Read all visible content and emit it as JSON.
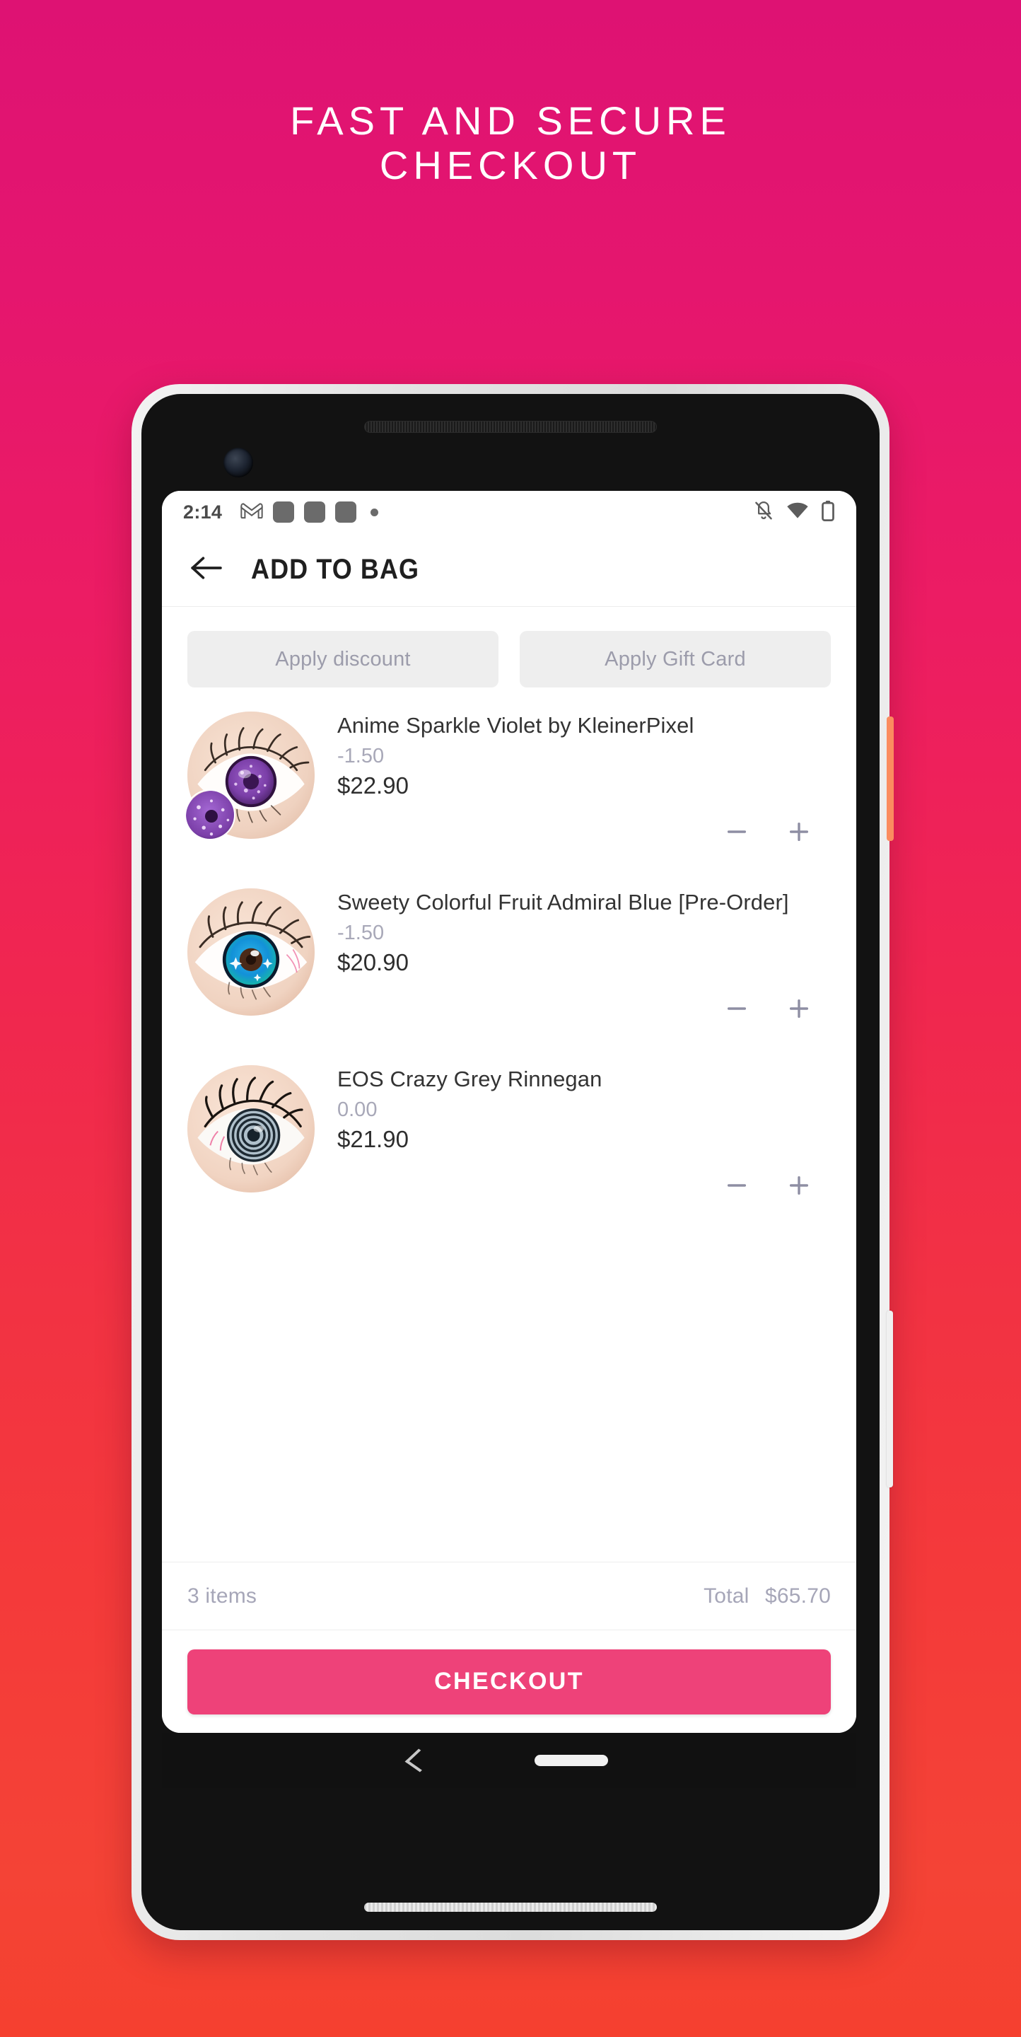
{
  "poster": {
    "headline": "FAST AND SECURE\nCHECKOUT",
    "bg_top_color": "#DE1273",
    "bg_bottom_color": "#F5402F"
  },
  "status_bar": {
    "time": "2:14",
    "left_icons": [
      "gmail-icon",
      "app-square-icon",
      "app-square-icon",
      "app-square-icon",
      "notification-dot-icon"
    ],
    "right_icons": [
      "bell-off-icon",
      "wifi-icon",
      "battery-icon"
    ]
  },
  "app_bar": {
    "back_icon": "arrow-left-icon",
    "title": "ADD TO BAG"
  },
  "promo": {
    "discount_label": "Apply discount",
    "gift_card_label": "Apply Gift Card"
  },
  "cart": {
    "items": [
      {
        "title": "Anime Sparkle Violet by KleinerPixel",
        "power": "-1.50",
        "price": "$22.90",
        "thumb_name": "product-thumb-anime-sparkle-violet",
        "has_swatch": true,
        "swatch_name": "color-swatch-violet",
        "iris_color": "#7B3FA8",
        "iris_color_2": "#9C5FC8",
        "iris_type": "sparkle",
        "minus_icon": "minus-icon",
        "plus_icon": "plus-icon"
      },
      {
        "title": "Sweety Colorful Fruit Admiral Blue [Pre-Order]",
        "power": "-1.50",
        "price": "$20.90",
        "thumb_name": "product-thumb-sweety-admiral-blue",
        "has_swatch": false,
        "swatch_name": "",
        "iris_color": "#1391D8",
        "iris_color_2": "#17B8A6",
        "iris_type": "sparkle",
        "minus_icon": "minus-icon",
        "plus_icon": "plus-icon"
      },
      {
        "title": "EOS Crazy Grey Rinnegan",
        "power": "0.00",
        "price": "$21.90",
        "thumb_name": "product-thumb-eos-crazy-grey-rinnegan",
        "has_swatch": false,
        "swatch_name": "",
        "iris_color": "#9FB0BC",
        "iris_color_2": "#5E7180",
        "iris_type": "rinnegan",
        "minus_icon": "minus-icon",
        "plus_icon": "plus-icon"
      }
    ]
  },
  "summary": {
    "item_count_label": "3 items",
    "total_label": "Total",
    "total_value": "$65.70"
  },
  "checkout": {
    "label": "CHECKOUT",
    "color": "#EE4279"
  },
  "device": {
    "power_button_color": "#FB8C5F",
    "volume_button_color": "#F0F0F0"
  }
}
